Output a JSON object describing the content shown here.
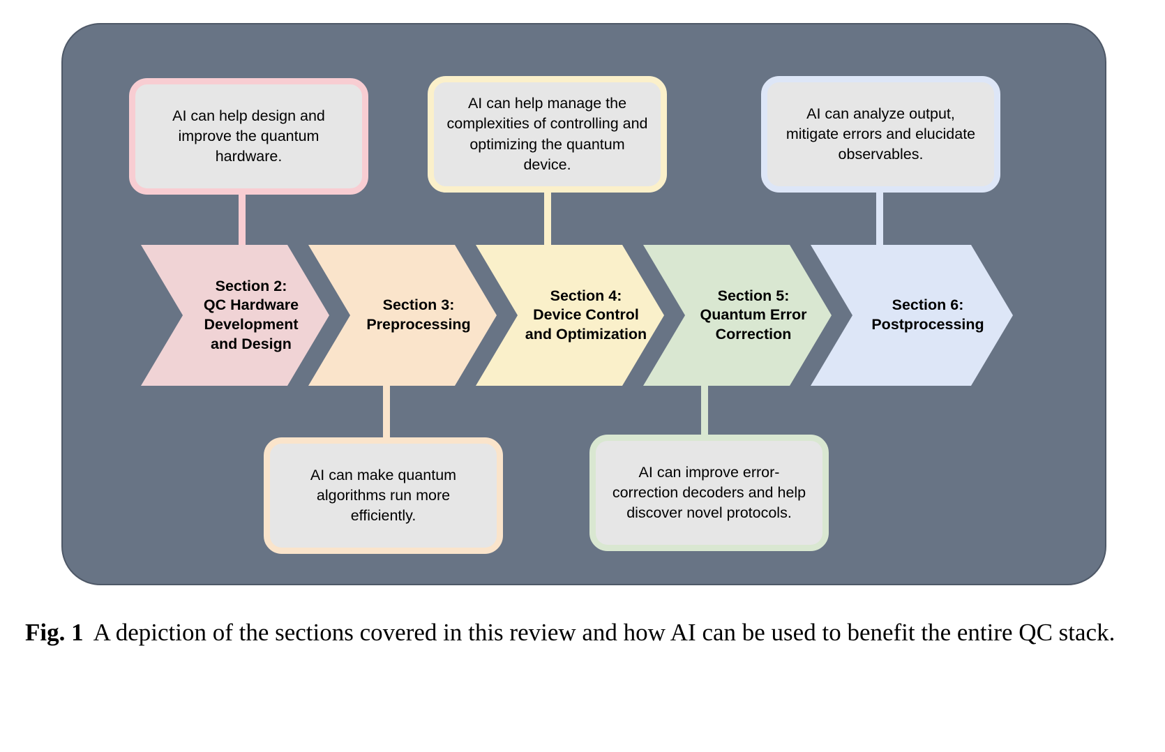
{
  "figure": {
    "panel_background": "#687485",
    "caption_label": "Fig. 1",
    "caption_text": "A depiction of the sections covered in this review and how AI can be used to benefit the entire QC stack."
  },
  "stages": [
    {
      "id": "section-2",
      "title_line1": "Section 2:",
      "title_line2": "QC Hardware",
      "title_line3": "Development",
      "title_line4": "and Design",
      "title_full": "Section 2:\nQC Hardware\nDevelopment\nand Design",
      "fill": "#f0d3d5",
      "accent": "#f8cdd2"
    },
    {
      "id": "section-3",
      "title_line1": "Section 3:",
      "title_line2": "Preprocessing",
      "title_full": "Section 3:\nPreprocessing",
      "fill": "#fae4cb",
      "accent": "#fae4cb"
    },
    {
      "id": "section-4",
      "title_line1": "Section 4:",
      "title_line2": "Device Control",
      "title_line3": "and Optimization",
      "title_full": "Section 4:\nDevice Control\nand Optimization",
      "fill": "#faf0ca",
      "accent": "#fbf0ca"
    },
    {
      "id": "section-5",
      "title_line1": "Section 5:",
      "title_line2": "Quantum Error",
      "title_line3": "Correction",
      "title_full": "Section 5:\nQuantum Error\nCorrection",
      "fill": "#d9e7d1",
      "accent": "#d9e7d1"
    },
    {
      "id": "section-6",
      "title_line1": "Section 6:",
      "title_line2": "Postprocessing",
      "title_full": "Section 6:\nPostprocessing",
      "fill": "#dde6f7",
      "accent": "#dde6f7"
    }
  ],
  "callouts": [
    {
      "id": "callout-hardware",
      "text": "AI can help design and improve the quantum hardware.",
      "border_color": "#f8cdd2",
      "position": "above",
      "linked_stage": "section-2"
    },
    {
      "id": "callout-preprocessing",
      "text": "AI can make quantum algorithms run more efficiently.",
      "border_color": "#fae4cb",
      "position": "below",
      "linked_stage": "section-3"
    },
    {
      "id": "callout-device-control",
      "text": "AI can help manage the complexities of controlling and optimizing the quantum device.",
      "border_color": "#fbf0ca",
      "position": "above",
      "linked_stage": "section-4"
    },
    {
      "id": "callout-qec",
      "text": "AI can improve error-correction decoders and help discover novel protocols.",
      "border_color": "#d9e7d1",
      "position": "below",
      "linked_stage": "section-5"
    },
    {
      "id": "callout-postprocessing",
      "text": "AI can analyze output, mitigate errors and elucidate observables.",
      "border_color": "#dde6f7",
      "position": "above",
      "linked_stage": "section-6"
    }
  ]
}
